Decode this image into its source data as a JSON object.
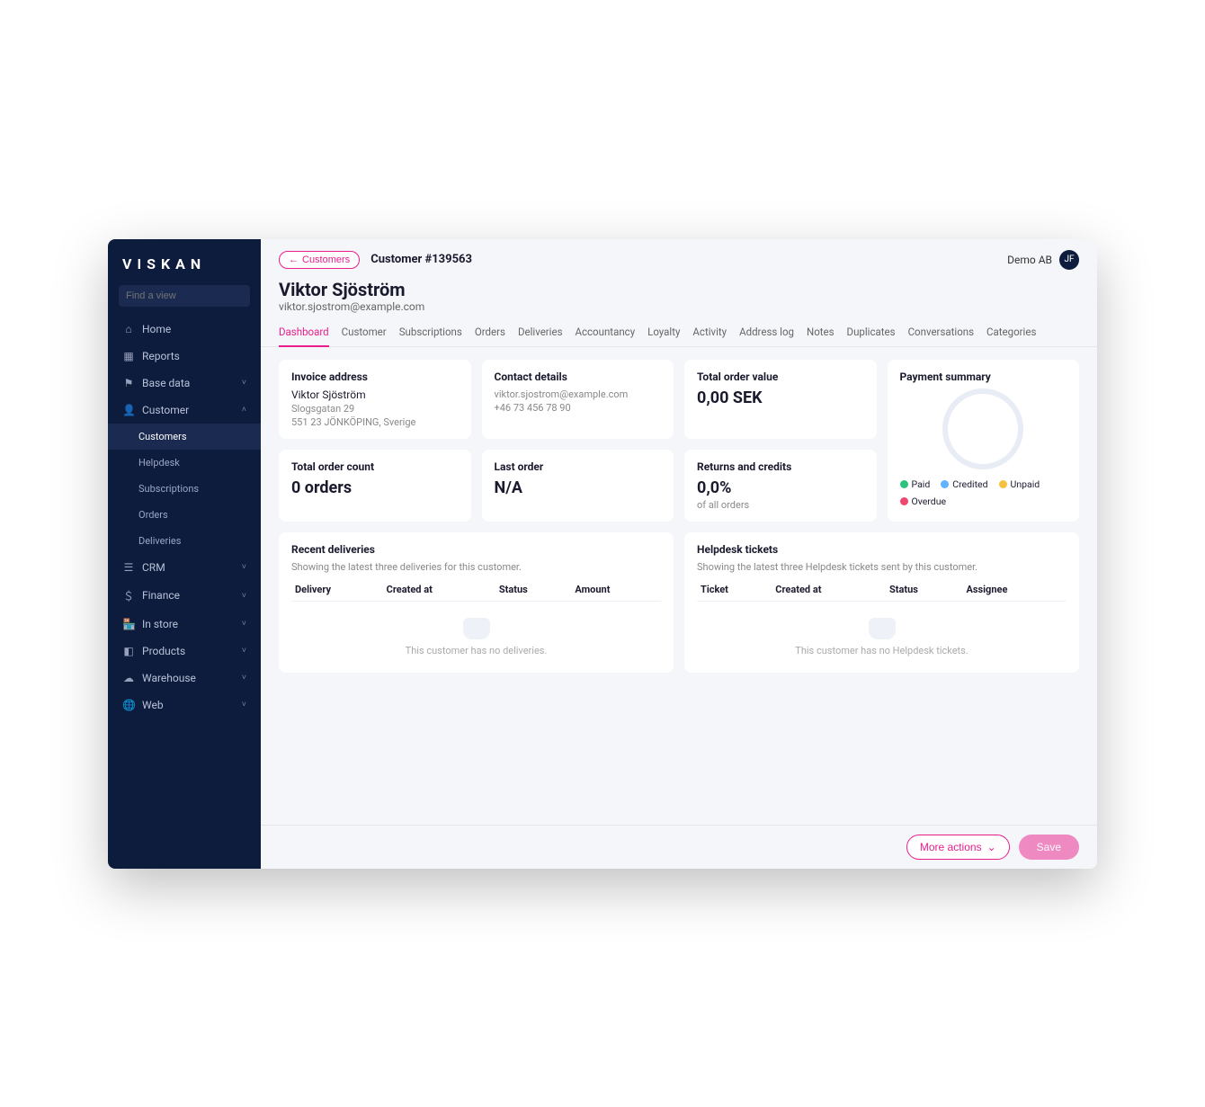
{
  "brand": "VISKAN",
  "search_placeholder": "Find a view",
  "sidebar": [
    {
      "icon": "⌂",
      "label": "Home"
    },
    {
      "icon": "▦",
      "label": "Reports"
    },
    {
      "icon": "⚑",
      "label": "Base data",
      "expand": true
    },
    {
      "icon": "👤",
      "label": "Customer",
      "expand": true,
      "open": true,
      "children": [
        {
          "label": "Customers",
          "active": true
        },
        {
          "label": "Helpdesk"
        },
        {
          "label": "Subscriptions"
        },
        {
          "label": "Orders"
        },
        {
          "label": "Deliveries"
        }
      ]
    },
    {
      "icon": "☰",
      "label": "CRM",
      "expand": true
    },
    {
      "icon": "＄",
      "label": "Finance",
      "expand": true
    },
    {
      "icon": "🏪",
      "label": "In store",
      "expand": true
    },
    {
      "icon": "◧",
      "label": "Products",
      "expand": true
    },
    {
      "icon": "☁",
      "label": "Warehouse",
      "expand": true
    },
    {
      "icon": "🌐",
      "label": "Web",
      "expand": true
    }
  ],
  "back_label": "Customers",
  "page_title": "Customer #139563",
  "tenant": "Demo AB",
  "avatar_initials": "JF",
  "customer": {
    "name": "Viktor Sjöström",
    "email": "viktor.sjostrom@example.com"
  },
  "tabs": [
    "Dashboard",
    "Customer",
    "Subscriptions",
    "Orders",
    "Deliveries",
    "Accountancy",
    "Loyalty",
    "Activity",
    "Address log",
    "Notes",
    "Duplicates",
    "Conversations",
    "Categories"
  ],
  "active_tab": "Dashboard",
  "cards": {
    "invoice_address": {
      "title": "Invoice address",
      "name": "Viktor Sjöström",
      "street": "Slogsgatan 29",
      "city": "551 23 JÖNKÖPING, Sverige"
    },
    "contact": {
      "title": "Contact details",
      "email": "viktor.sjostrom@example.com",
      "phone": "+46 73 456 78 90"
    },
    "total_value": {
      "title": "Total order value",
      "value": "0,00 SEK"
    },
    "payment": {
      "title": "Payment summary"
    },
    "total_count": {
      "title": "Total order count",
      "value": "0 orders"
    },
    "last_order": {
      "title": "Last order",
      "value": "N/A"
    },
    "returns": {
      "title": "Returns and credits",
      "value": "0,0%",
      "sub": "of all orders"
    }
  },
  "payment_legend": [
    {
      "color": "#2ec27e",
      "label": "Paid"
    },
    {
      "color": "#5fb3ff",
      "label": "Credited"
    },
    {
      "color": "#f5c23e",
      "label": "Unpaid"
    },
    {
      "color": "#ef476f",
      "label": "Overdue"
    }
  ],
  "deliveries": {
    "title": "Recent deliveries",
    "hint": "Showing the latest three deliveries for this customer.",
    "cols": [
      "Delivery",
      "Created at",
      "Status",
      "Amount"
    ],
    "empty": "This customer has no deliveries."
  },
  "tickets": {
    "title": "Helpdesk tickets",
    "hint": "Showing the latest three Helpdesk tickets sent by this customer.",
    "cols": [
      "Ticket",
      "Created at",
      "Status",
      "Assignee"
    ],
    "empty": "This customer has no Helpdesk tickets."
  },
  "footer": {
    "more": "More actions",
    "save": "Save"
  }
}
